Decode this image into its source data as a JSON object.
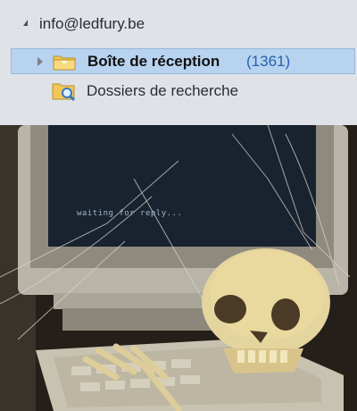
{
  "account": {
    "name": "info@ledfury.be"
  },
  "folders": {
    "inbox": {
      "label": "Boîte de réception",
      "count": "(1361)"
    },
    "search_folders": {
      "label": "Dossiers de recherche"
    }
  },
  "illustration": {
    "screen_text": "waiting for reply..."
  },
  "colors": {
    "pane_bg": "#dfe3e8",
    "selection_bg": "#b7d3ef",
    "count_blue": "#2a5fb0"
  }
}
